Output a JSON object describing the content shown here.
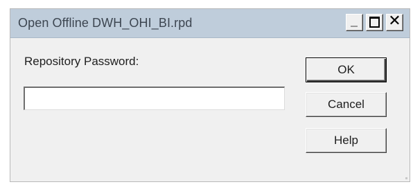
{
  "window": {
    "title": "Open Offline DWH_OHI_BI.rpd"
  },
  "form": {
    "password_label": "Repository Password:",
    "password_value": ""
  },
  "buttons": {
    "ok": "OK",
    "cancel": "Cancel",
    "help": "Help"
  },
  "icons": {
    "minimize": "minimize-icon",
    "maximize": "maximize-icon",
    "close": "close-icon"
  },
  "colors": {
    "titlebar": "#bfcddb",
    "dialog_bg": "#f0f0f0"
  }
}
